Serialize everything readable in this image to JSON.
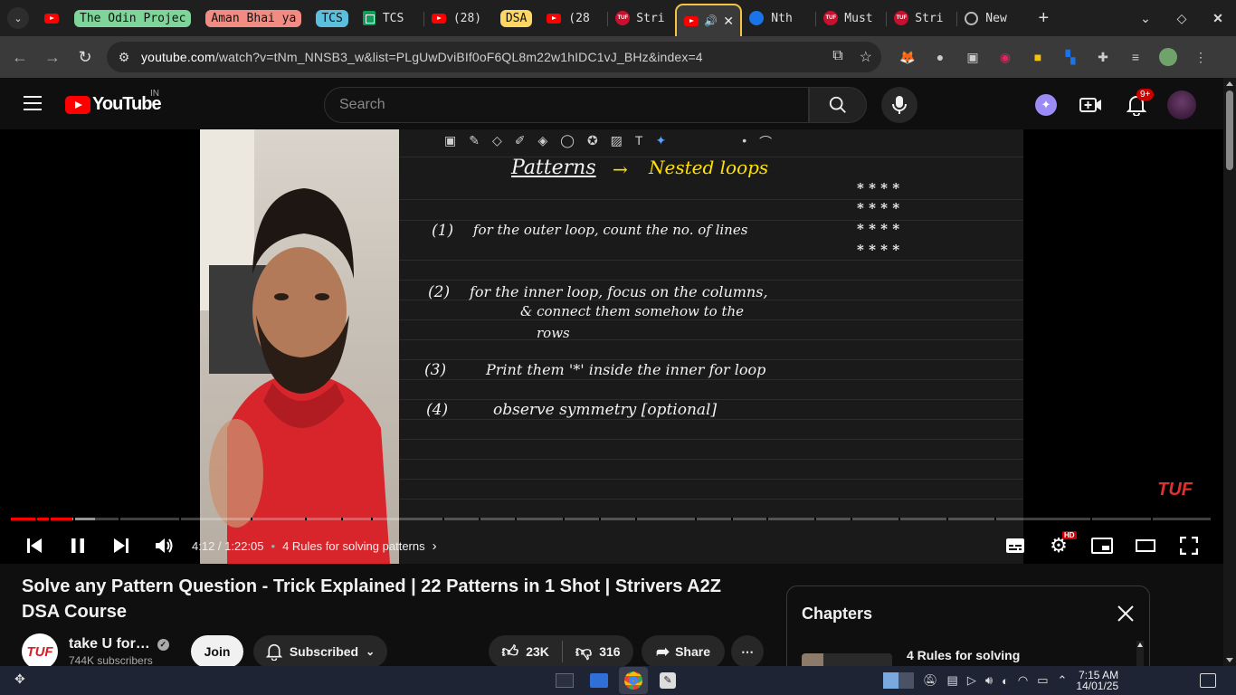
{
  "browser": {
    "tabs": [
      {
        "type": "pinned-youtube"
      },
      {
        "type": "group",
        "label": "The Odin Projec",
        "color": "#7fd49a"
      },
      {
        "type": "group",
        "label": "Aman Bhai ya",
        "color": "#f28b82"
      },
      {
        "type": "group",
        "label": "TCS",
        "color": "#5bc0de"
      },
      {
        "type": "sheet",
        "title": "TCS"
      },
      {
        "type": "youtube",
        "title": "(28)"
      },
      {
        "type": "group",
        "label": "DSA",
        "color": "#fdd663"
      },
      {
        "type": "youtube",
        "title": "(28"
      },
      {
        "type": "tuf",
        "title": "Stri"
      },
      {
        "type": "active",
        "audio": true
      },
      {
        "type": "blue",
        "title": "Nth"
      },
      {
        "type": "tuf",
        "title": "Must"
      },
      {
        "type": "tuf",
        "title": "Stri"
      },
      {
        "type": "globe",
        "title": "New"
      }
    ],
    "new_tab": "+",
    "url_host": "youtube.com",
    "url_path": "/watch?v=tNm_NNSB3_w&list=PLgUwDviBIf0oF6QL8m22w1hIDC1vJ_BHz&index=4"
  },
  "youtube": {
    "country": "IN",
    "logo_text": "YouTube",
    "search_placeholder": "Search",
    "notif_count": "9+"
  },
  "player": {
    "time": "4:12 / 1:22:05",
    "separator": "•",
    "chapter": "4 Rules for solving patterns",
    "played_fraction": 0.051,
    "loaded_fraction": 0.07,
    "quality_badge": "HD",
    "watermark": "TUF",
    "notes": {
      "title": "Patterns",
      "arrow": "→",
      "subtitle": "Nested loops",
      "rule1_num": "(1)",
      "rule1": "for the outer loop, count the no. of lines",
      "rule2_num": "(2)",
      "rule2a": "for the inner loop, focus on the columns,",
      "rule2b": "& connect them somehow to the",
      "rule2c": "rows",
      "rule3_num": "(3)",
      "rule3": "Print them '*' inside the inner for loop",
      "rule4_num": "(4)",
      "rule4": "observe   symmetry   [optional]",
      "star_row": "* * * *"
    }
  },
  "video": {
    "title": "Solve any Pattern Question - Trick Explained | 22 Patterns in 1 Shot | Strivers A2Z DSA Course",
    "channel_avatar": "TUF",
    "channel": "take U for…",
    "subscribers": "744K subscribers",
    "join": "Join",
    "subscribed": "Subscribed",
    "likes": "23K",
    "dislikes": "316",
    "share": "Share"
  },
  "chapters": {
    "heading": "Chapters",
    "item": "4 Rules for solving"
  },
  "taskbar": {
    "time": "7:15 AM",
    "date": "14/01/25"
  }
}
